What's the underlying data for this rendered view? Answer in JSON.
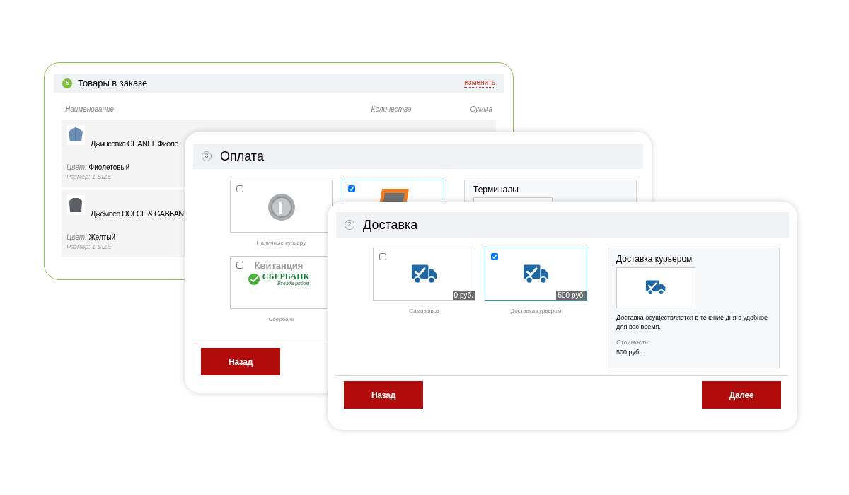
{
  "order": {
    "step": "5",
    "title": "Товары в заказе",
    "edit_link": "изменить",
    "columns": [
      "Наименование",
      "Количество",
      "Сумма"
    ],
    "items": [
      {
        "kind": "jacket",
        "name": "Джинсовка CHANEL Фиоле",
        "color_label": "Цвет:",
        "color_value": "Фиолетовый",
        "size": "Размер: 1 SIZE"
      },
      {
        "kind": "sweater",
        "name": "Джемпер DOLCE & GABBAN",
        "color_label": "Цвет:",
        "color_value": "Желтый",
        "size": "Размер: 1 SIZE"
      }
    ]
  },
  "payment": {
    "step": "3",
    "title": "Оплата",
    "options": [
      {
        "kind": "coin",
        "label": "Наличные курьеру",
        "selected": false
      },
      {
        "kind": "terminal",
        "selected": true
      },
      {
        "kind": "sberbank",
        "label": "Сбербанк",
        "caption": "Квитанция",
        "bank": "СБЕРБАНК",
        "tagline": "Всегда рядом",
        "selected": false
      }
    ],
    "panel_title": "Терминалы",
    "back": "Назад"
  },
  "delivery": {
    "step": "2",
    "title": "Доставка",
    "options": [
      {
        "label": "Самовывоз",
        "price": "0 руб.",
        "selected": false
      },
      {
        "label": "Доставка курьером",
        "price": "500 руб.",
        "selected": true
      }
    ],
    "info": {
      "title": "Доставка курьером",
      "description": "Доставка осуществляется в течение дня в удобное для вас время.",
      "cost_label": "Стоимость:",
      "cost": "500 руб."
    },
    "back": "Назад",
    "next": "Далее"
  }
}
